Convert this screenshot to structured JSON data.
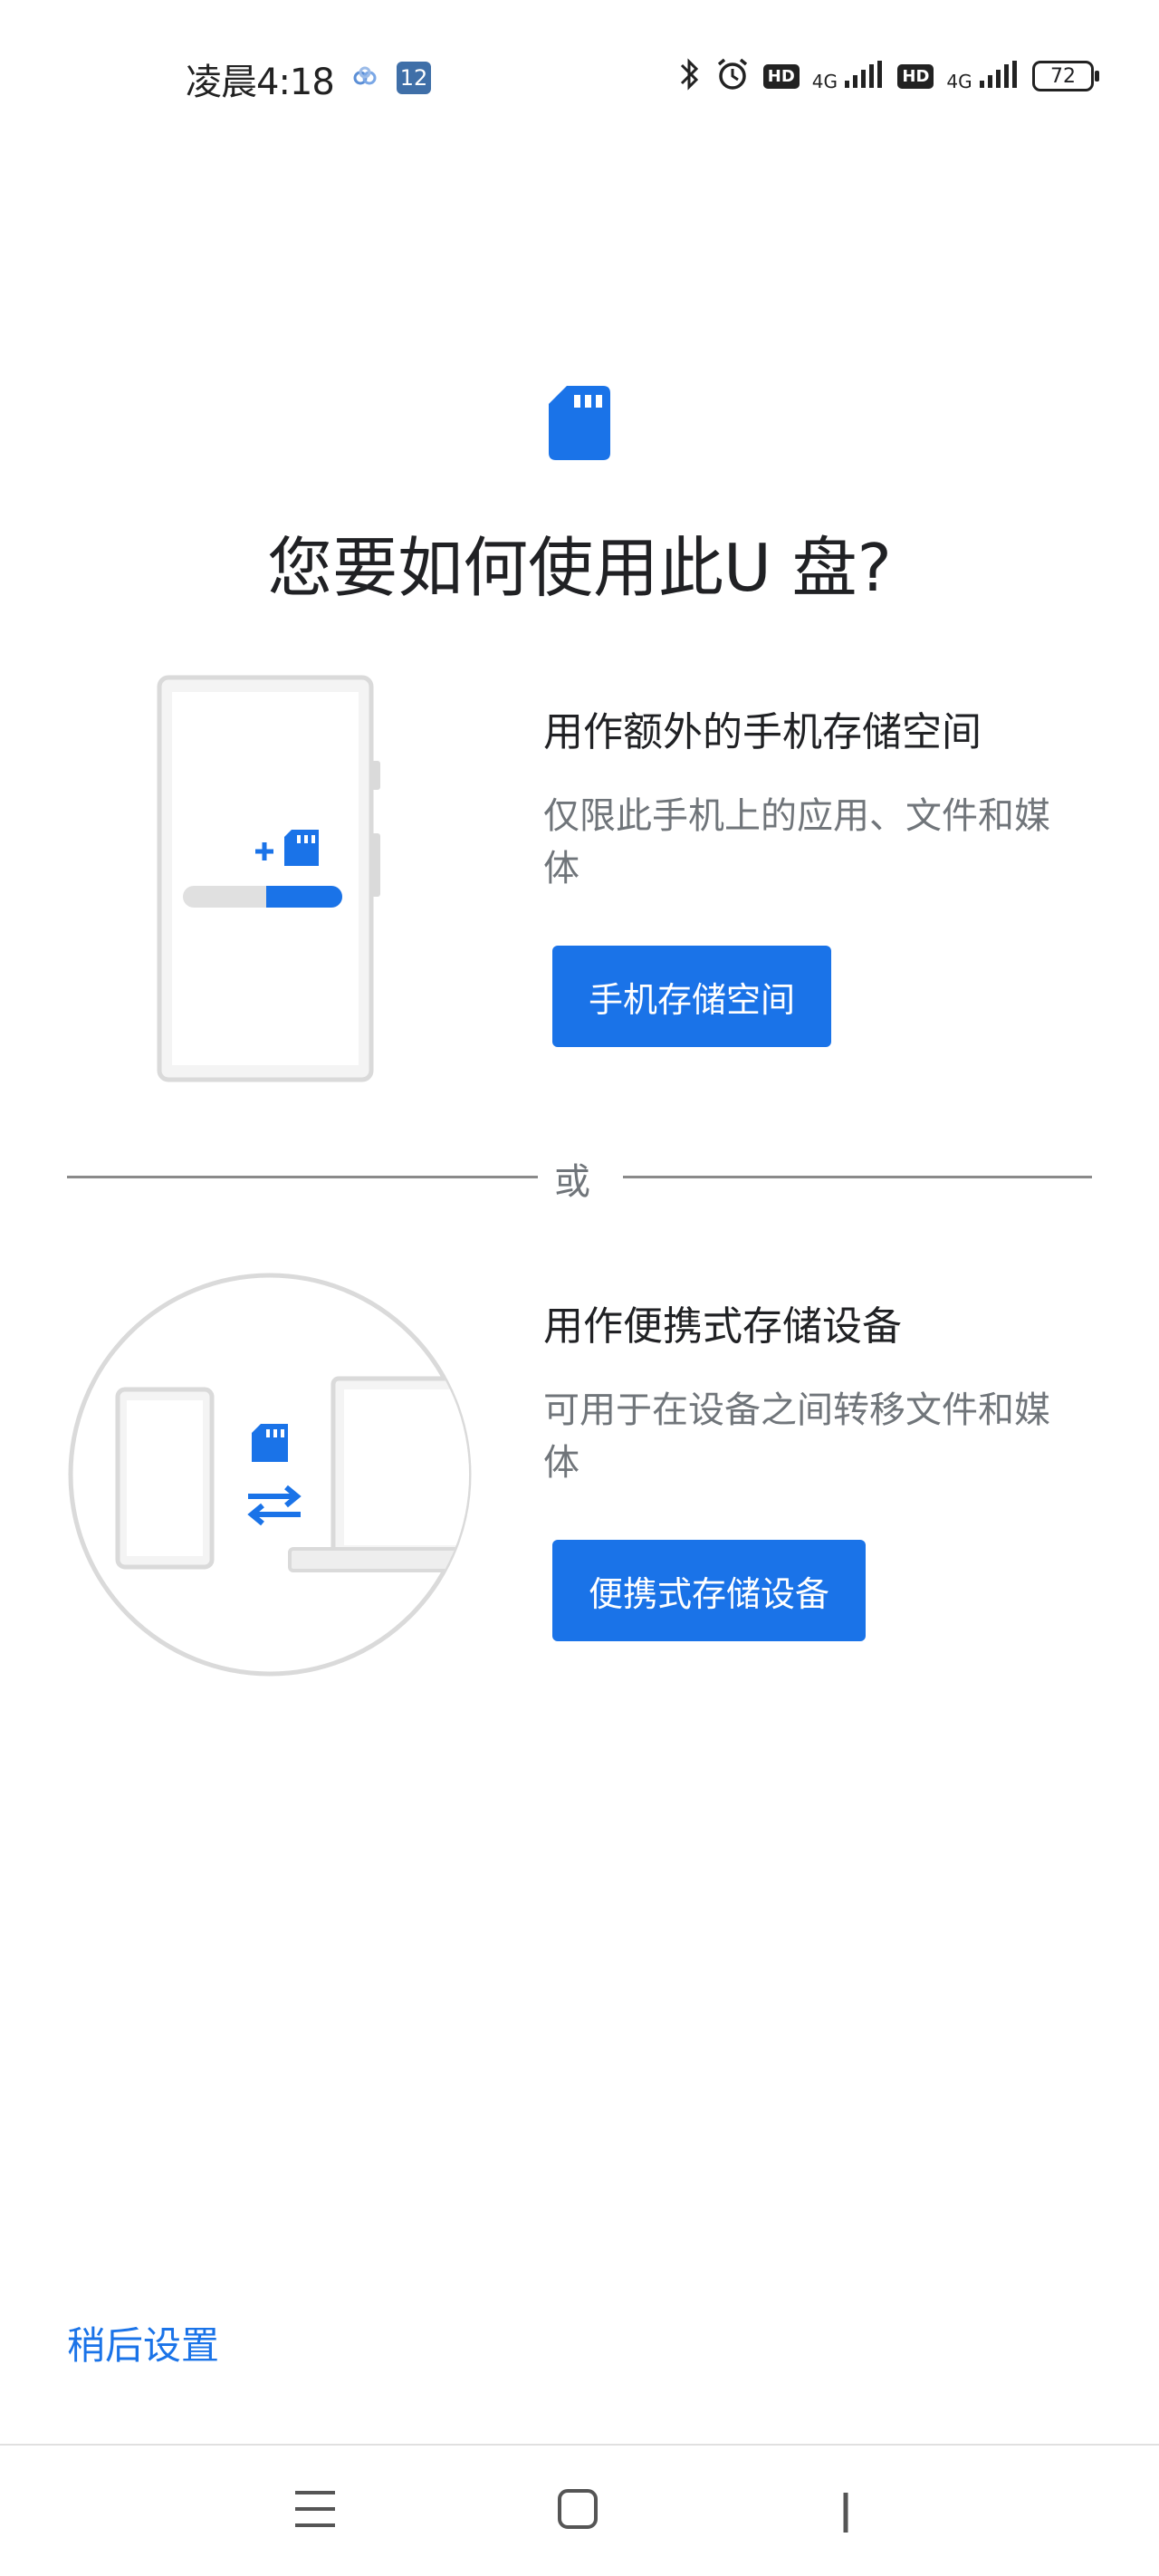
{
  "status_bar": {
    "time": "凌晨4:18",
    "notif_badge": "12",
    "network_1": "4G",
    "network_2": "4G",
    "hd_1": "HD",
    "hd_2": "HD",
    "battery": "72"
  },
  "page": {
    "title": "您要如何使用此U 盘?",
    "or_label": "或",
    "later_label": "稍后设置"
  },
  "options": [
    {
      "title": "用作额外的手机存储空间",
      "description": "仅限此手机上的应用、文件和媒体",
      "button_label": "手机存储空间"
    },
    {
      "title": "用作便携式存储设备",
      "description": "可用于在设备之间转移文件和媒体",
      "button_label": "便携式存储设备"
    }
  ],
  "colors": {
    "accent": "#1a73e8",
    "text_primary": "#202124",
    "text_secondary": "#70757a"
  },
  "icons": {
    "header": "sd-card-icon",
    "nav_menu": "menu-icon",
    "nav_home": "home-icon",
    "nav_back": "back-icon"
  }
}
